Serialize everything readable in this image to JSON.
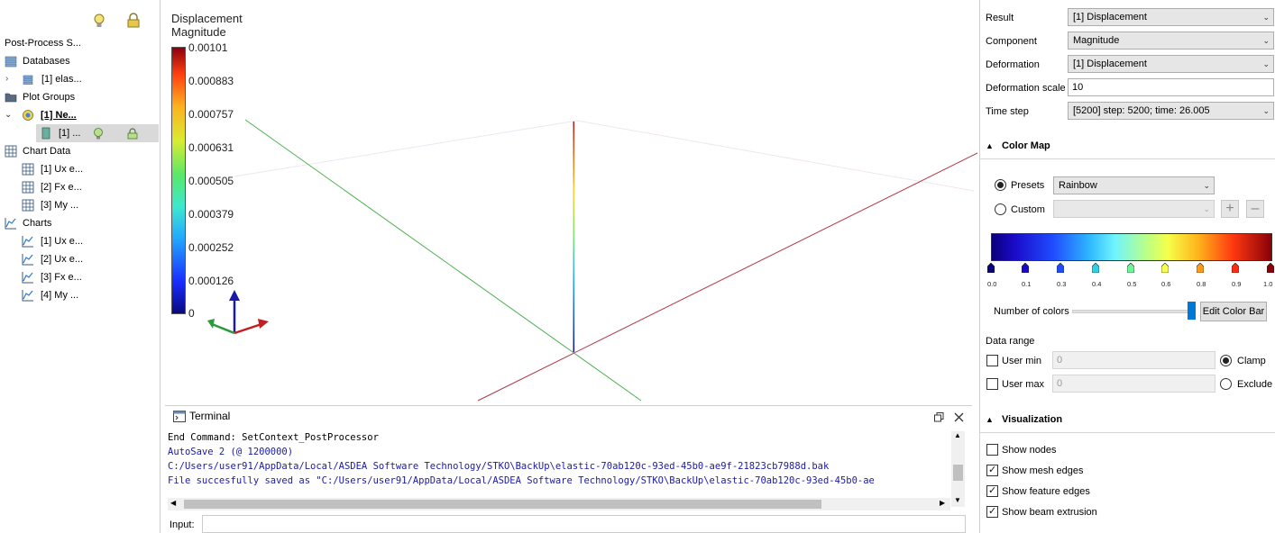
{
  "left_tree": {
    "root_label": "Post-Process S...",
    "items": [
      {
        "label": "Databases"
      },
      {
        "label": "[1] elas..."
      },
      {
        "label": "Plot Groups"
      },
      {
        "label": "[1] Ne..."
      },
      {
        "label": "[1] ..."
      },
      {
        "label": "Chart Data"
      },
      {
        "label": "[1] Ux e..."
      },
      {
        "label": "[2] Fx e..."
      },
      {
        "label": "[3] My ..."
      },
      {
        "label": "Charts"
      },
      {
        "label": "[1] Ux e..."
      },
      {
        "label": "[2] Ux e..."
      },
      {
        "label": "[3] Fx e..."
      },
      {
        "label": "[4] My ..."
      }
    ]
  },
  "viewport": {
    "legend_title_1": "Displacement",
    "legend_title_2": "Magnitude",
    "legend_ticks": [
      "0.00101",
      "0.000883",
      "0.000757",
      "0.000631",
      "0.000505",
      "0.000379",
      "0.000252",
      "0.000126",
      "0"
    ]
  },
  "terminal": {
    "title": "Terminal",
    "lines": [
      {
        "text": "End Command: SetContext_PostProcessor",
        "color": "black"
      },
      {
        "text": "AutoSave 2 (@ 1200000)",
        "color": "blue"
      },
      {
        "text": "C:/Users/user91/AppData/Local/ASDEA Software Technology/STKO\\BackUp\\elastic-70ab120c-93ed-45b0-ae9f-21823cb7988d.bak",
        "color": "blue"
      },
      {
        "text": "File succesfully saved as \"C:/Users/user91/AppData/Local/ASDEA Software Technology/STKO\\BackUp\\elastic-70ab120c-93ed-45b0-ae",
        "color": "blue"
      }
    ],
    "input_label": "Input:",
    "input_value": ""
  },
  "properties": {
    "result_label": "Result",
    "result_value": "[1] Displacement",
    "component_label": "Component",
    "component_value": "Magnitude",
    "deformation_label": "Deformation",
    "deformation_value": "[1] Displacement",
    "deformation_scale_label": "Deformation scale",
    "deformation_scale_value": "10",
    "time_step_label": "Time step",
    "time_step_value": "[5200] step: 5200; time: 26.005"
  },
  "color_map": {
    "section_title": "Color Map",
    "presets_label": "Presets",
    "presets_value": "Rainbow",
    "custom_label": "Custom",
    "custom_value": "",
    "stop_labels": [
      "0.0",
      "0.1",
      "0.3",
      "0.4",
      "0.5",
      "0.6",
      "0.8",
      "0.9",
      "1.0"
    ],
    "stop_colors": [
      "#0a007a",
      "#1a0ac8",
      "#1f4cff",
      "#2fd0e8",
      "#6ff49a",
      "#f6ff4a",
      "#ff9a1a",
      "#ff2a10",
      "#8a0008"
    ],
    "number_of_colors_label": "Number of colors",
    "edit_color_bar_label": "Edit Color Bar",
    "data_range_label": "Data range",
    "user_min_label": "User min",
    "user_min_value": "0",
    "user_max_label": "User max",
    "user_max_value": "0",
    "clamp_label": "Clamp",
    "exclude_label": "Exclude"
  },
  "visualization": {
    "section_title": "Visualization",
    "show_nodes_label": "Show nodes",
    "show_mesh_edges_label": "Show mesh edges",
    "show_feature_edges_label": "Show feature edges",
    "show_beam_extrusion_label": "Show beam extrusion"
  }
}
